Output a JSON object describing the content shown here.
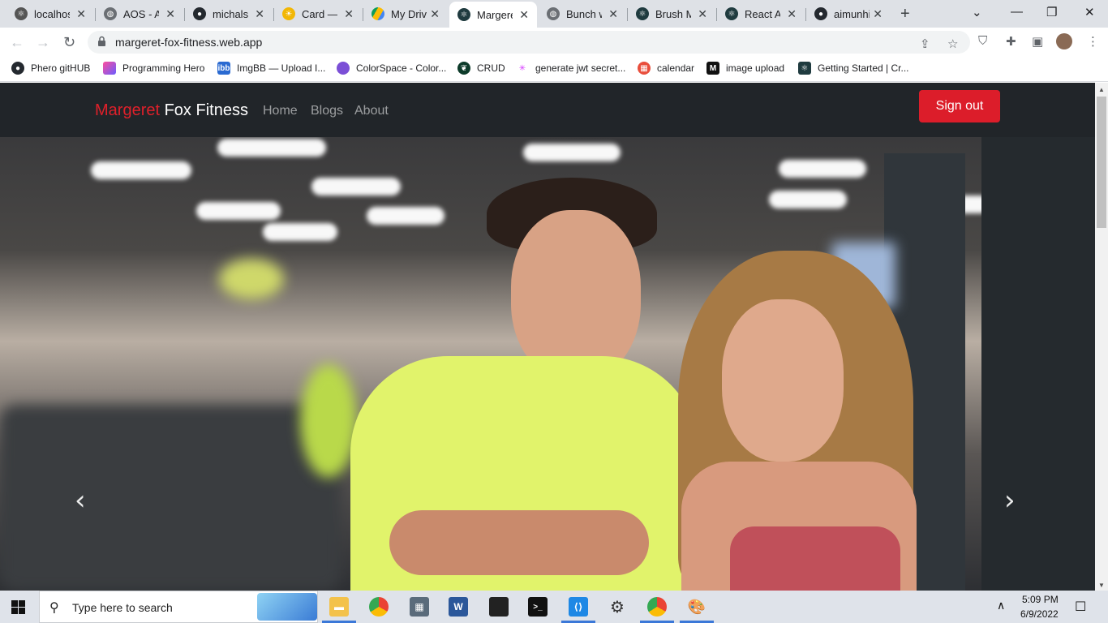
{
  "browser": {
    "tabs": [
      {
        "label": "localhos",
        "icon": "react-icon"
      },
      {
        "label": "AOS - Ar",
        "icon": "globe-icon"
      },
      {
        "label": "michalsn",
        "icon": "github-icon"
      },
      {
        "label": "Card — ",
        "icon": "sun-icon"
      },
      {
        "label": "My Drive",
        "icon": "google-drive-icon"
      },
      {
        "label": "Margere",
        "icon": "react-icon",
        "active": true
      },
      {
        "label": "Bunch w",
        "icon": "globe-icon"
      },
      {
        "label": "Brush M",
        "icon": "react-icon"
      },
      {
        "label": "React Ap",
        "icon": "react-icon"
      },
      {
        "label": "aimunhi",
        "icon": "github-icon"
      }
    ],
    "url": "margeret-fox-fitness.web.app",
    "bookmarks": [
      {
        "label": "Phero gitHUB",
        "icon": "github-icon"
      },
      {
        "label": "Programming Hero",
        "icon": "programming-hero-icon"
      },
      {
        "label": "ImgBB — Upload I...",
        "icon": "imgbb-icon"
      },
      {
        "label": "ColorSpace - Color...",
        "icon": "colorspace-icon"
      },
      {
        "label": "CRUD",
        "icon": "mongodb-icon"
      },
      {
        "label": "generate jwt secret...",
        "icon": "jwt-icon"
      },
      {
        "label": "calendar",
        "icon": "calendar-icon"
      },
      {
        "label": "image upload",
        "icon": "image-upload-icon"
      },
      {
        "label": "Getting Started | Cr...",
        "icon": "react-icon"
      }
    ]
  },
  "site": {
    "brand_first": "Margeret",
    "brand_rest": "Fox Fitness",
    "nav": {
      "home": "Home",
      "blogs": "Blogs",
      "about": "About"
    },
    "signout_label": "Sign out",
    "carousel": {
      "prev": "‹",
      "next": "›"
    },
    "colors": {
      "brand_red": "#dc1d2a",
      "navbar_bg": "#212529"
    }
  },
  "taskbar": {
    "search_placeholder": "Type here to search",
    "time": "5:09 PM",
    "date": "6/9/2022",
    "apps": [
      "file-explorer-icon",
      "chrome-icon",
      "calculator-icon",
      "word-icon",
      "sticky-notes-icon",
      "terminal-icon",
      "vscode-icon",
      "settings-icon",
      "chrome-icon",
      "paint-icon"
    ]
  }
}
